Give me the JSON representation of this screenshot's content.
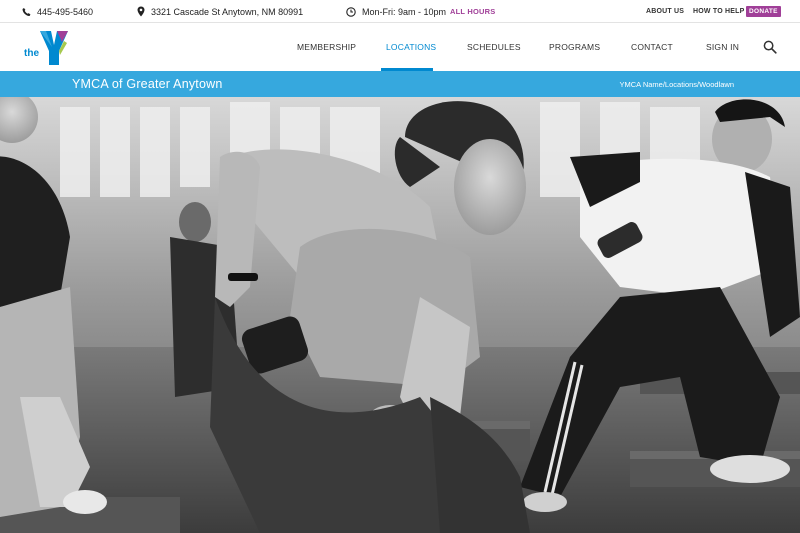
{
  "utility_bar": {
    "phone": "445-495-5460",
    "address": "3321 Cascade St Anytown, NM 80991",
    "hours": "Mon-Fri: 9am - 10pm",
    "all_hours_link": "ALL HOURS",
    "about_link": "ABOUT US",
    "help_link": "HOW TO HELP",
    "donate_button": "DONATE",
    "icons": [
      "phone-icon",
      "map-pin-icon",
      "clock-icon"
    ]
  },
  "logo": {
    "text": "the",
    "alt": "YMCA logo"
  },
  "nav": {
    "items": [
      {
        "label": "MEMBERSHIP"
      },
      {
        "label": "LOCATIONS",
        "active": true
      },
      {
        "label": "SCHEDULES"
      },
      {
        "label": "PROGRAMS"
      },
      {
        "label": "CONTACT"
      },
      {
        "label": "SIGN IN"
      }
    ],
    "search_icon": "search-icon"
  },
  "banner": {
    "title": "YMCA of Greater Anytown",
    "breadcrumb": "YMCA Name/Locations/Woodlawn"
  },
  "hero": {
    "image": "black-and-white fitness class photo"
  },
  "colors": {
    "accent_blue": "#0089d0",
    "banner_blue": "#36a8de",
    "purple": "#a03f98",
    "logo_green": "#9cc33c"
  }
}
